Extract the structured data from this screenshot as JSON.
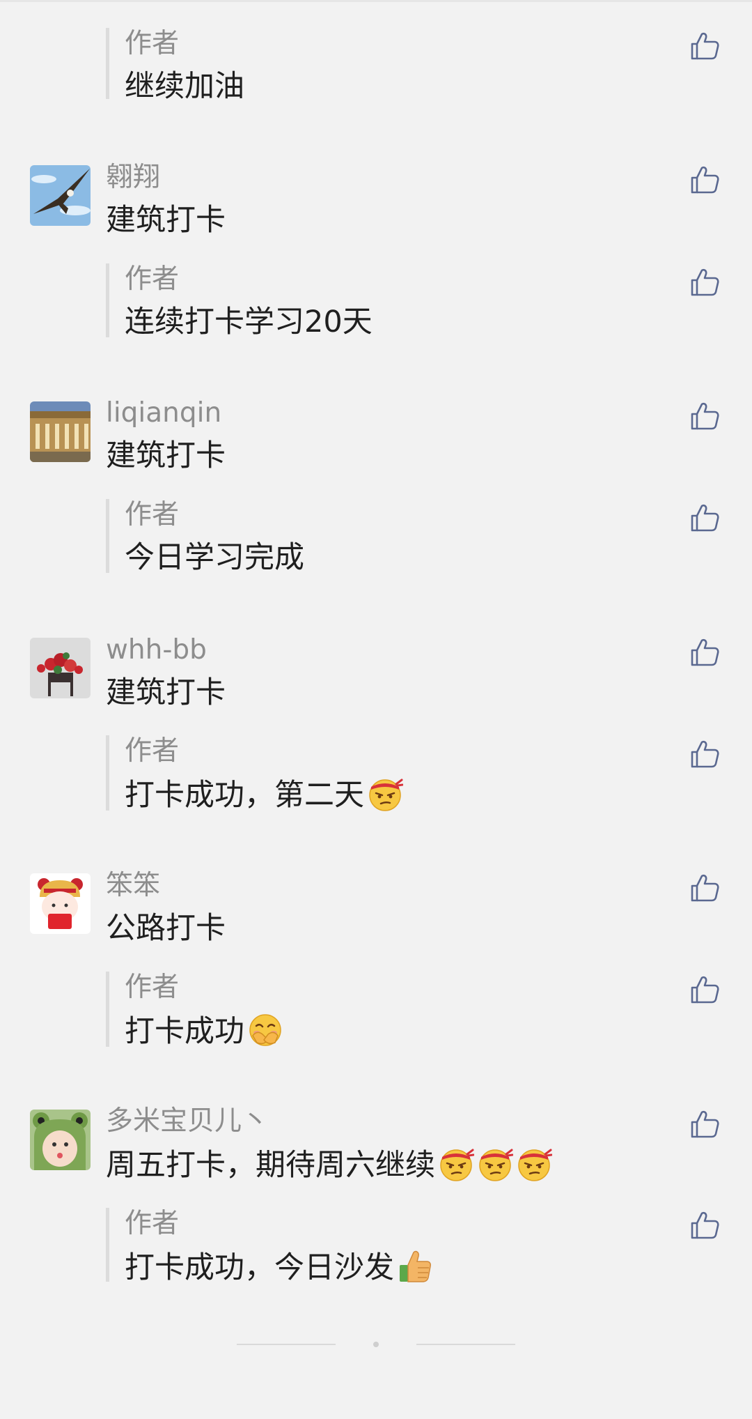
{
  "comments_list": {
    "items": [
      {
        "reply_author": "作者",
        "reply_text": "继续加油"
      },
      {
        "username": "翱翔",
        "text": "建筑打卡",
        "reply_author": "作者",
        "reply_text": "连续打卡学习20天"
      },
      {
        "username": "liqianqin",
        "text": "建筑打卡",
        "reply_author": "作者",
        "reply_text": "今日学习完成"
      },
      {
        "username": "whh-bb",
        "text": "建筑打卡",
        "reply_author": "作者",
        "reply_text": "打卡成功，第二天",
        "reply_emoji": "smirk-ninja-emoji"
      },
      {
        "username": "笨笨",
        "text": "公路打卡",
        "reply_author": "作者",
        "reply_text": "打卡成功",
        "reply_emoji": "hiding-laugh-emoji"
      },
      {
        "username": "多米宝贝儿丶",
        "text": "周五打卡，期待周六继续",
        "text_emojis": [
          "smirk-ninja-emoji",
          "smirk-ninja-emoji",
          "smirk-ninja-emoji"
        ],
        "reply_author": "作者",
        "reply_text": "打卡成功，今日沙发",
        "reply_emoji": "thumbs-up-emoji"
      }
    ]
  },
  "icons": {
    "like": "thumbs-up-outline-icon"
  },
  "colors": {
    "background": "#f2f2f2",
    "username": "#8d8d8d",
    "text": "#1f1f1f",
    "like_icon": "#5a6890"
  }
}
